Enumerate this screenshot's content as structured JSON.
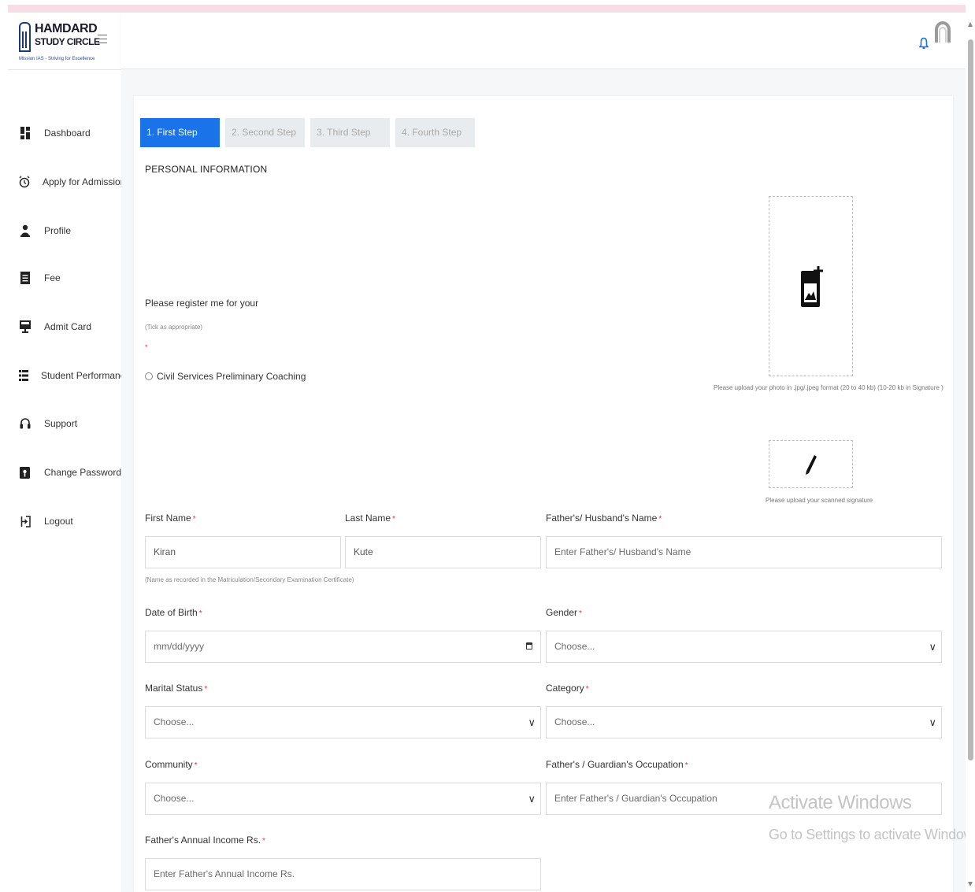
{
  "brand": {
    "title": "HAMDARD",
    "subtitle": "STUDY CIRCLE",
    "tagline": "Mission IAS - Striving for Excellence"
  },
  "sidebar": {
    "items": [
      {
        "label": "Dashboard",
        "icon": "dashboard-icon"
      },
      {
        "label": "Apply for Admission",
        "icon": "alarm-clock-icon"
      },
      {
        "label": "Profile",
        "icon": "user-icon"
      },
      {
        "label": "Fee",
        "icon": "receipt-icon"
      },
      {
        "label": "Admit Card",
        "icon": "id-card-icon"
      },
      {
        "label": "Student Performance",
        "icon": "list-icon"
      },
      {
        "label": "Support",
        "icon": "headset-icon"
      },
      {
        "label": "Change Password",
        "icon": "key-box-icon"
      },
      {
        "label": "Logout",
        "icon": "logout-icon"
      }
    ]
  },
  "steps": [
    "1. First Step",
    "2. Second Step",
    "3. Third Step",
    "4. Fourth Step"
  ],
  "section_title": "PERSONAL INFORMATION",
  "register": {
    "prompt": "Please register me for your",
    "tick_hint": "(Tick as appropriate)",
    "required_mark": "*",
    "option": "Civil Services Preliminary Coaching"
  },
  "uploads": {
    "photo_hint": "Please upload your photo in .jpg/.jpeg format (20 to 40 kb) (10-20 kb in Signature )",
    "signature_hint": "Please upload your scanned signature"
  },
  "form": {
    "first_name": {
      "label": "First Name",
      "value": "Kiran"
    },
    "last_name": {
      "label": "Last Name",
      "value": "Kute"
    },
    "father_name": {
      "label": "Father's/ Husband's Name",
      "placeholder": "Enter Father's/ Husband's Name"
    },
    "name_note": "(Name as recorded in the Matriculation/Secondary Examination Certificate)",
    "dob": {
      "label": "Date of Birth",
      "placeholder": "mm/dd/yyyy"
    },
    "gender": {
      "label": "Gender",
      "selected": "Choose..."
    },
    "marital_status": {
      "label": "Marital Status",
      "selected": "Choose..."
    },
    "category": {
      "label": "Category",
      "selected": "Choose..."
    },
    "community": {
      "label": "Community",
      "selected": "Choose..."
    },
    "occupation": {
      "label": "Father's / Guardian's Occupation",
      "placeholder": "Enter Father's / Guardian's Occupation"
    },
    "income": {
      "label": "Father's Annual Income Rs.",
      "placeholder": "Enter Father's Annual Income Rs."
    },
    "required_mark": "*"
  },
  "watermark": {
    "line1": "Activate Windows",
    "line2": "Go to Settings to activate Windows."
  },
  "colors": {
    "accent": "#1a73e8",
    "required": "#e53935",
    "bell": "#1a73e8"
  }
}
